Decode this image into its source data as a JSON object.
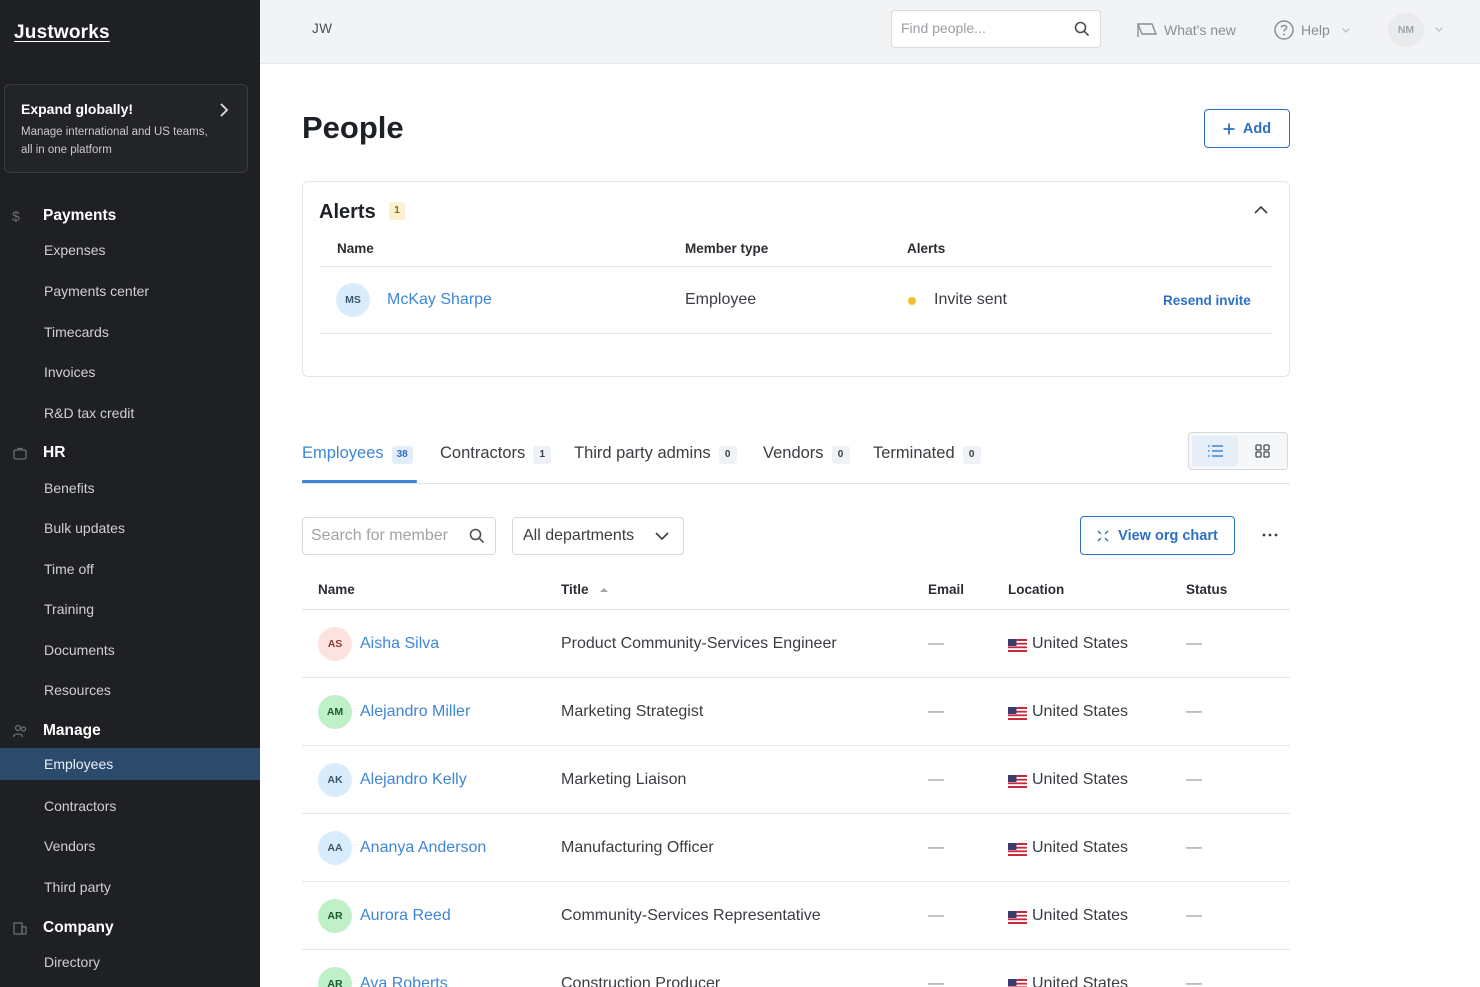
{
  "sidebar": {
    "logo": "Justworks",
    "promo": {
      "title": "Expand globally!",
      "text": "Manage international and US teams, all in one platform"
    },
    "sections": [
      {
        "label": "Payments",
        "icon": "dollar-icon",
        "items": [
          "Expenses",
          "Payments center",
          "Timecards",
          "Invoices",
          "R&D tax credit"
        ]
      },
      {
        "label": "HR",
        "icon": "briefcase-icon",
        "items": [
          "Benefits",
          "Bulk updates",
          "Time off",
          "Training",
          "Documents",
          "Resources"
        ]
      },
      {
        "label": "Manage",
        "icon": "people-icon",
        "items": [
          "Employees",
          "Contractors",
          "Vendors",
          "Third party"
        ]
      },
      {
        "label": "Company",
        "icon": "building-icon",
        "items": [
          "Directory"
        ]
      }
    ],
    "active_item": "Employees"
  },
  "topbar": {
    "company_code": "JW",
    "search_placeholder": "Find people...",
    "whats_new": "What's new",
    "help": "Help",
    "user_initials": "NM"
  },
  "page": {
    "title": "People",
    "add_label": "Add"
  },
  "alerts": {
    "title": "Alerts",
    "count": "1",
    "columns": [
      "Name",
      "Member type",
      "Alerts"
    ],
    "rows": [
      {
        "initials": "MS",
        "name": "McKay Sharpe",
        "member_type": "Employee",
        "alert": "Invite sent",
        "action": "Resend invite"
      }
    ]
  },
  "tabs": [
    {
      "label": "Employees",
      "count": "38",
      "active": true
    },
    {
      "label": "Contractors",
      "count": "1",
      "active": false
    },
    {
      "label": "Third party admins",
      "count": "0",
      "active": false
    },
    {
      "label": "Vendors",
      "count": "0",
      "active": false
    },
    {
      "label": "Terminated",
      "count": "0",
      "active": false
    }
  ],
  "filters": {
    "search_placeholder": "Search for member",
    "department": "All departments",
    "org_chart_label": "View org chart",
    "more_label": "···"
  },
  "table": {
    "columns": {
      "name": "Name",
      "title": "Title",
      "email": "Email",
      "location": "Location",
      "status": "Status"
    },
    "rows": [
      {
        "initials": "AS",
        "name": "Aisha Silva",
        "title": "Product Community-Services Engineer",
        "email": "—",
        "location": "United States",
        "status": "—",
        "avatar_bg": "#fde3e0",
        "avatar_fg": "#8a3a32"
      },
      {
        "initials": "AM",
        "name": "Alejandro Miller",
        "title": "Marketing Strategist",
        "email": "—",
        "location": "United States",
        "status": "—",
        "avatar_bg": "#bff0c8",
        "avatar_fg": "#1f5a2e"
      },
      {
        "initials": "AK",
        "name": "Alejandro Kelly",
        "title": "Marketing Liaison",
        "email": "—",
        "location": "United States",
        "status": "—",
        "avatar_bg": "#d9ecfb",
        "avatar_fg": "#3a5670"
      },
      {
        "initials": "AA",
        "name": "Ananya Anderson",
        "title": "Manufacturing Officer",
        "email": "—",
        "location": "United States",
        "status": "—",
        "avatar_bg": "#d9ecfb",
        "avatar_fg": "#3a5670"
      },
      {
        "initials": "AR",
        "name": "Aurora Reed",
        "title": "Community-Services Representative",
        "email": "—",
        "location": "United States",
        "status": "—",
        "avatar_bg": "#bff0c8",
        "avatar_fg": "#1f5a2e"
      },
      {
        "initials": "AR",
        "name": "Ava Roberts",
        "title": "Construction Producer",
        "email": "—",
        "location": "United States",
        "status": "—",
        "avatar_bg": "#bff0c8",
        "avatar_fg": "#1f5a2e"
      }
    ]
  },
  "colors": {
    "accent": "#2d6fc7",
    "link": "#3e86d8",
    "sidebar_bg": "#1f2023",
    "sidebar_active": "#2c4a6b",
    "alert_dot": "#f2c12e"
  }
}
